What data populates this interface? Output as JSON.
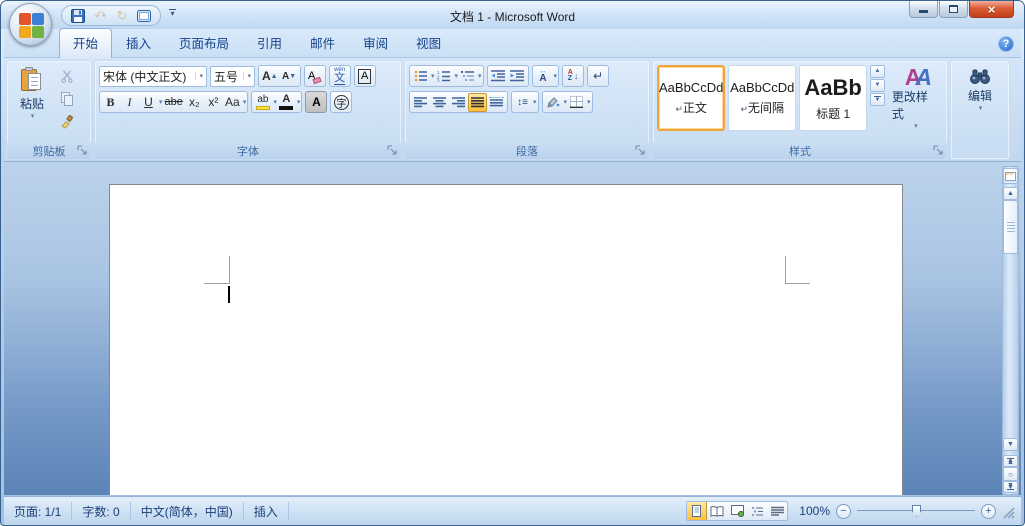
{
  "titlebar": {
    "title": "文档 1 - Microsoft Word"
  },
  "tabs": {
    "items": [
      "开始",
      "插入",
      "页面布局",
      "引用",
      "邮件",
      "审阅",
      "视图"
    ]
  },
  "help": {
    "glyph": "?"
  },
  "ribbon": {
    "clipboard": {
      "group_label": "剪贴板",
      "paste_label": "粘贴"
    },
    "font": {
      "group_label": "字体",
      "name_value": "宋体 (中文正文)",
      "size_value": "五号",
      "grow_glyph": "A",
      "shrink_glyph": "A",
      "clear_glyph": "A",
      "pinyin_top": "wén",
      "pinyin_glyph": "文",
      "char_border_glyph": "A",
      "bold_glyph": "B",
      "italic_glyph": "I",
      "underline_glyph": "U",
      "strike_glyph": "abe",
      "subscript_glyph": "x₂",
      "superscript_glyph": "x²",
      "case_glyph": "Aa",
      "highlight_glyph": "ab",
      "color_glyph": "A",
      "shading_glyph": "A",
      "enclose_glyph": "字"
    },
    "paragraph": {
      "group_label": "段落",
      "sort_a": "A",
      "sort_z": "Z",
      "asian_glyph": "A",
      "showhide_glyph": "↵",
      "linespace_glyph": "↕≡"
    },
    "styles": {
      "group_label": "样式",
      "items": [
        {
          "preview": "AaBbCcDd",
          "mark": "↵",
          "name": "正文"
        },
        {
          "preview": "AaBbCcDd",
          "mark": "↵",
          "name": "无间隔"
        },
        {
          "preview": "AaBb",
          "mark": "",
          "name": "标题 1"
        }
      ],
      "change_styles_label": "更改样式",
      "change_icon_a": "A",
      "change_icon_b": "A"
    },
    "editing": {
      "group_label": "编辑"
    }
  },
  "statusbar": {
    "page": "页面: 1/1",
    "words": "字数: 0",
    "language": "中文(简体，中国)",
    "insert_mode": "插入",
    "zoom_level": "100%"
  }
}
